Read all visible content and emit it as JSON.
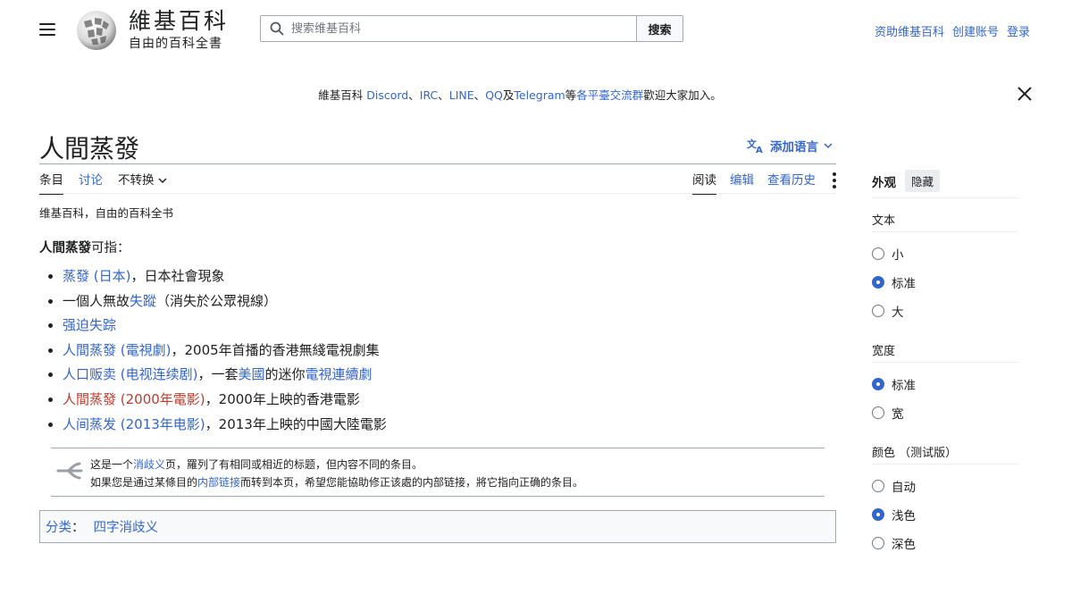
{
  "header": {
    "wordmark": "維基百科",
    "tagline": "自由的百科全書",
    "search_placeholder": "搜索维基百科",
    "search_button": "搜索",
    "user_links": [
      "资助维基百科",
      "创建账号",
      "登录"
    ]
  },
  "banner": {
    "prefix": "維基百科 ",
    "discord": "Discord",
    "sep1": "、",
    "irc": "IRC",
    "sep2": "、",
    "line": "LINE",
    "sep3": "、",
    "qq": "QQ",
    "and": "及",
    "telegram": "Telegram",
    "deng": "等",
    "platforms": "各平臺交流群",
    "suffix": "歡迎大家加入。"
  },
  "page": {
    "title": "人間蒸發",
    "add_language": "添加语言",
    "tabs_left": {
      "article": "条目",
      "talk": "讨论",
      "variant": "不转换"
    },
    "tabs_right": {
      "read": "阅读",
      "edit": "编辑",
      "history": "查看历史"
    },
    "site_sub": "维基百科，自由的百科全书",
    "lead_bold": "人間蒸發",
    "lead_rest": "可指："
  },
  "items": [
    {
      "link": "蒸發 (日本)",
      "rest": "，日本社會現象"
    },
    {
      "pre": "一個人無故",
      "link": "失蹤",
      "rest": "（消失於公眾視線）"
    },
    {
      "link": "强迫失踪"
    },
    {
      "link": "人間蒸發 (電視劇)",
      "rest": "，2005年首播的香港無綫電視劇集"
    },
    {
      "link": "人口贩卖 (电视连续剧)",
      "rest": "，一套",
      "link2": "美國",
      "rest2": "的迷你",
      "link3": "電視連續劇"
    },
    {
      "link": "人間蒸發 (2000年電影)",
      "rest": "，2000年上映的香港電影"
    },
    {
      "link": "人间蒸发 (2013年电影)",
      "rest": "，2013年上映的中國大陸電影"
    }
  ],
  "disambig": {
    "line1_pre": "这是一个",
    "line1_link": "消歧义",
    "line1_rest": "页，羅列了有相同或相近的标题，但内容不同的条目。",
    "line2_pre": "如果您是通过某條目的",
    "line2_link": "内部链接",
    "line2_rest": "而转到本页，希望您能協助修正该處的内部链接，將它指向正确的条目。"
  },
  "categories": {
    "label": "分类",
    "colon": "：",
    "items": [
      "四字消歧义"
    ]
  },
  "sidebar": {
    "title": "外观",
    "hide": "隐藏",
    "text_label": "文本",
    "text_options": [
      "小",
      "标准",
      "大"
    ],
    "width_label": "宽度",
    "width_options": [
      "标准",
      "宽"
    ],
    "color_label": "颜色 （测试版）",
    "color_options": [
      "自动",
      "浅色",
      "深色"
    ]
  },
  "colors": {
    "link": "#3366cc",
    "redlink": "#bf3c2c",
    "text": "#202122"
  }
}
